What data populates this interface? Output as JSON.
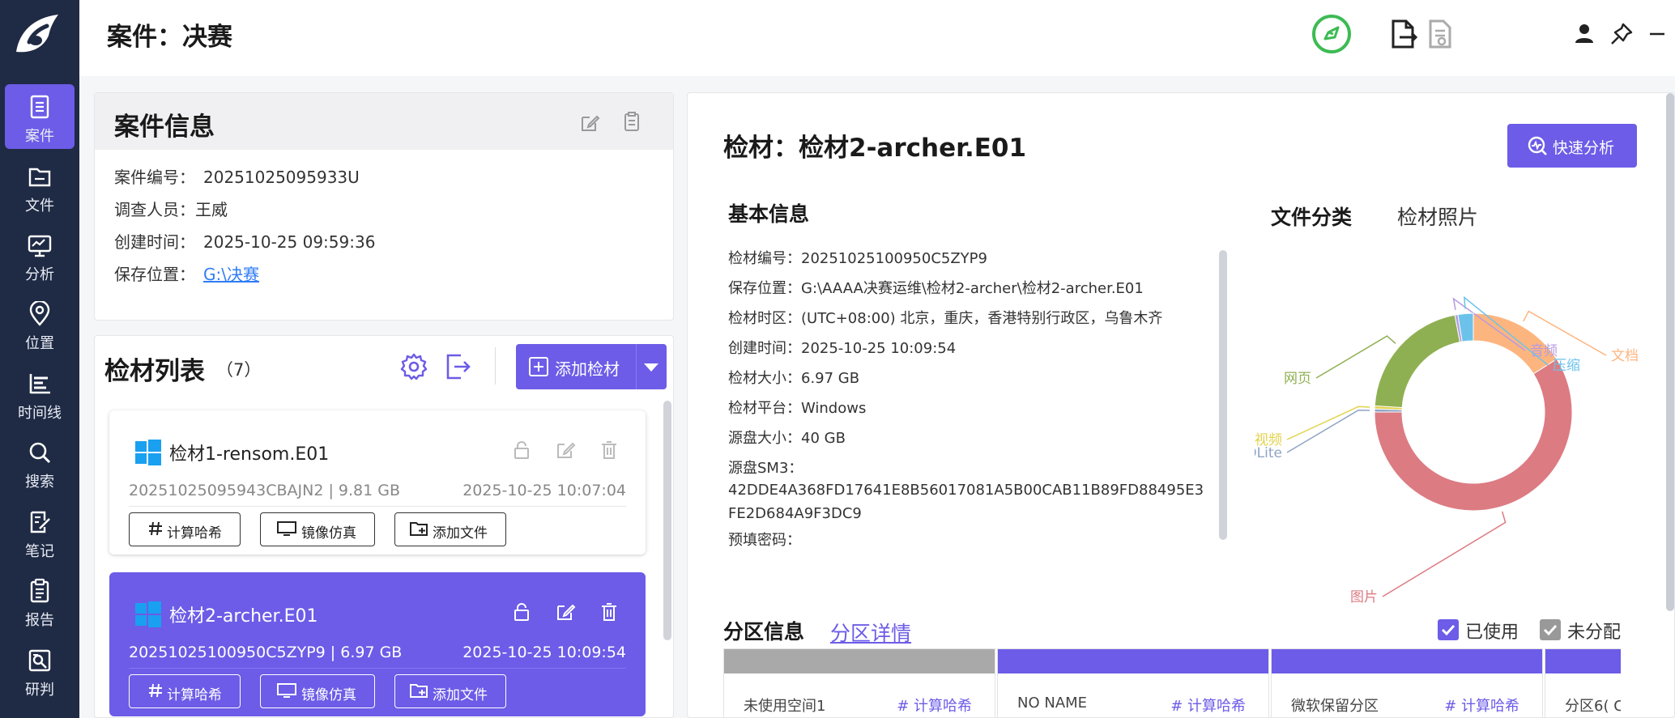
{
  "app": {
    "title": "案件：决赛"
  },
  "sidebar": {
    "items": [
      {
        "label": "案件",
        "icon": "case-icon",
        "active": true
      },
      {
        "label": "文件",
        "icon": "file-icon"
      },
      {
        "label": "分析",
        "icon": "analysis-icon"
      },
      {
        "label": "位置",
        "icon": "location-icon"
      },
      {
        "label": "时间线",
        "icon": "timeline-icon"
      },
      {
        "label": "搜索",
        "icon": "search-icon"
      },
      {
        "label": "笔记",
        "icon": "note-icon"
      },
      {
        "label": "报告",
        "icon": "report-icon"
      },
      {
        "label": "研判",
        "icon": "judge-icon"
      }
    ]
  },
  "case_info": {
    "title": "案件信息",
    "number_label": "案件编号：",
    "number": "20251025095933U",
    "investigator_label": "调查人员：",
    "investigator": "王威",
    "created_label": "创建时间：",
    "created": "2025-10-25 09:59:36",
    "location_label": "保存位置：",
    "location": "G:\\决赛"
  },
  "evidence_list": {
    "title": "检材列表",
    "count": "（7）",
    "add_button": "添加检材",
    "items": [
      {
        "name": "检材1-rensom.E01",
        "meta": "20251025095943CBAJN2 | 9.81 GB",
        "time": "2025-10-25 10:07:04",
        "selected": false
      },
      {
        "name": "检材2-archer.E01",
        "meta": "20251025100950C5ZYP9 | 6.97 GB",
        "time": "2025-10-25 10:09:54",
        "selected": true
      }
    ],
    "btn_hash": "计算哈希",
    "btn_mirror": "镜像仿真",
    "btn_addfile": "添加文件"
  },
  "detail": {
    "title": "检材：检材2-archer.E01",
    "quick_button": "快速分析",
    "basic_title": "基本信息",
    "basic": {
      "id": "检材编号：20251025100950C5ZYP9",
      "path": "保存位置：G:\\AAAA决赛运维\\检材2-archer\\检材2-archer.E01",
      "tz": "检材时区：(UTC+08:00) 北京，重庆，香港特别行政区，乌鲁木齐",
      "created": "创建时间：2025-10-25 10:09:54",
      "size": "检材大小：6.97 GB",
      "platform": "检材平台：Windows",
      "disk": "源盘大小：40 GB",
      "sm3_label": "源盘SM3：",
      "sm3": "42DDE4A368FD17641E8B56017081A5B00CAB11B89FD88495E3FE2D684A9F3DC9",
      "pwd": "预填密码："
    },
    "tab_file_class": "文件分类",
    "tab_photo": "检材照片",
    "partition": {
      "title": "分区信息",
      "link": "分区详情",
      "chk_used": "已使用",
      "chk_unalloc": "未分配",
      "cards": [
        {
          "name": "未使用空间1",
          "hash": "# 计算哈希",
          "bar": "#a9a9a9"
        },
        {
          "name": "NO NAME",
          "hash": "# 计算哈希",
          "bar": "#6c5ce7"
        },
        {
          "name": "微软保留分区",
          "hash": "# 计算哈希",
          "bar": "#6c5ce7"
        },
        {
          "name": "分区6( C",
          "hash": "",
          "bar": "#6c5ce7"
        }
      ]
    }
  },
  "chart_data": {
    "type": "pie",
    "style": "donut",
    "legend_placement": "labels-outside",
    "slices": [
      {
        "label": "文档",
        "value": 16,
        "color": "#fdb57f"
      },
      {
        "label": "图片",
        "value": 59,
        "color": "#dc7b82"
      },
      {
        "label": "SQLite",
        "value": 0.5,
        "color": "#8fa4c4"
      },
      {
        "label": "视频",
        "value": 0.5,
        "color": "#e3d24b"
      },
      {
        "label": "网页",
        "value": 21,
        "color": "#8fb052"
      },
      {
        "label": "音频",
        "value": 0.5,
        "color": "#b59be0"
      },
      {
        "label": "压缩",
        "value": 2.5,
        "color": "#6cc2ea"
      }
    ]
  },
  "colors": {
    "accent": "#6c5ce7",
    "sidebar": "#1f2a44",
    "link": "#2f7cf6"
  }
}
